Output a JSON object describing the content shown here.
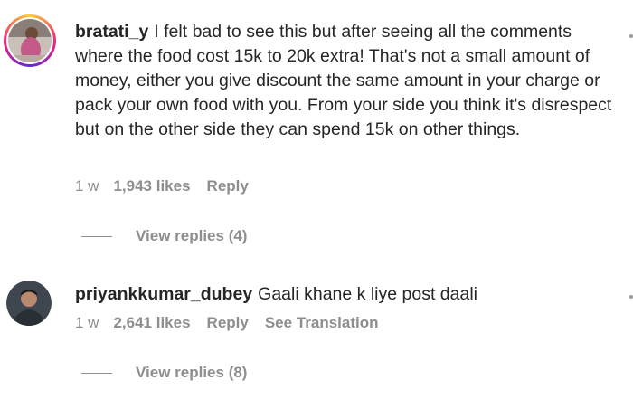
{
  "comments": [
    {
      "username": "bratati_y",
      "text": "I felt bad to see this but after seeing all the comments where the food cost 15k to 20k extra! That's not a small amount of money, either you give discount the same amount in your charge or pack your own food with you. From your side you think it's disrespect but on the other side they can spend 15k on other things.",
      "time": "1 w",
      "likes": "1,943 likes",
      "reply_label": "Reply",
      "view_replies": "View replies (4)",
      "avatar_style": "story-ring"
    },
    {
      "username": "priyankkumar_dubey",
      "text": "Gaali khane k liye post daali",
      "time": "1 w",
      "likes": "2,641 likes",
      "reply_label": "Reply",
      "translation_label": "See Translation",
      "view_replies": "View replies (8)",
      "avatar_style": "plain"
    }
  ],
  "colors": {
    "text": "#262626",
    "secondary": "#8e8e8e",
    "ring_start": "#f9ce34",
    "ring_mid": "#ee2a7b",
    "ring_end": "#6228d7"
  }
}
